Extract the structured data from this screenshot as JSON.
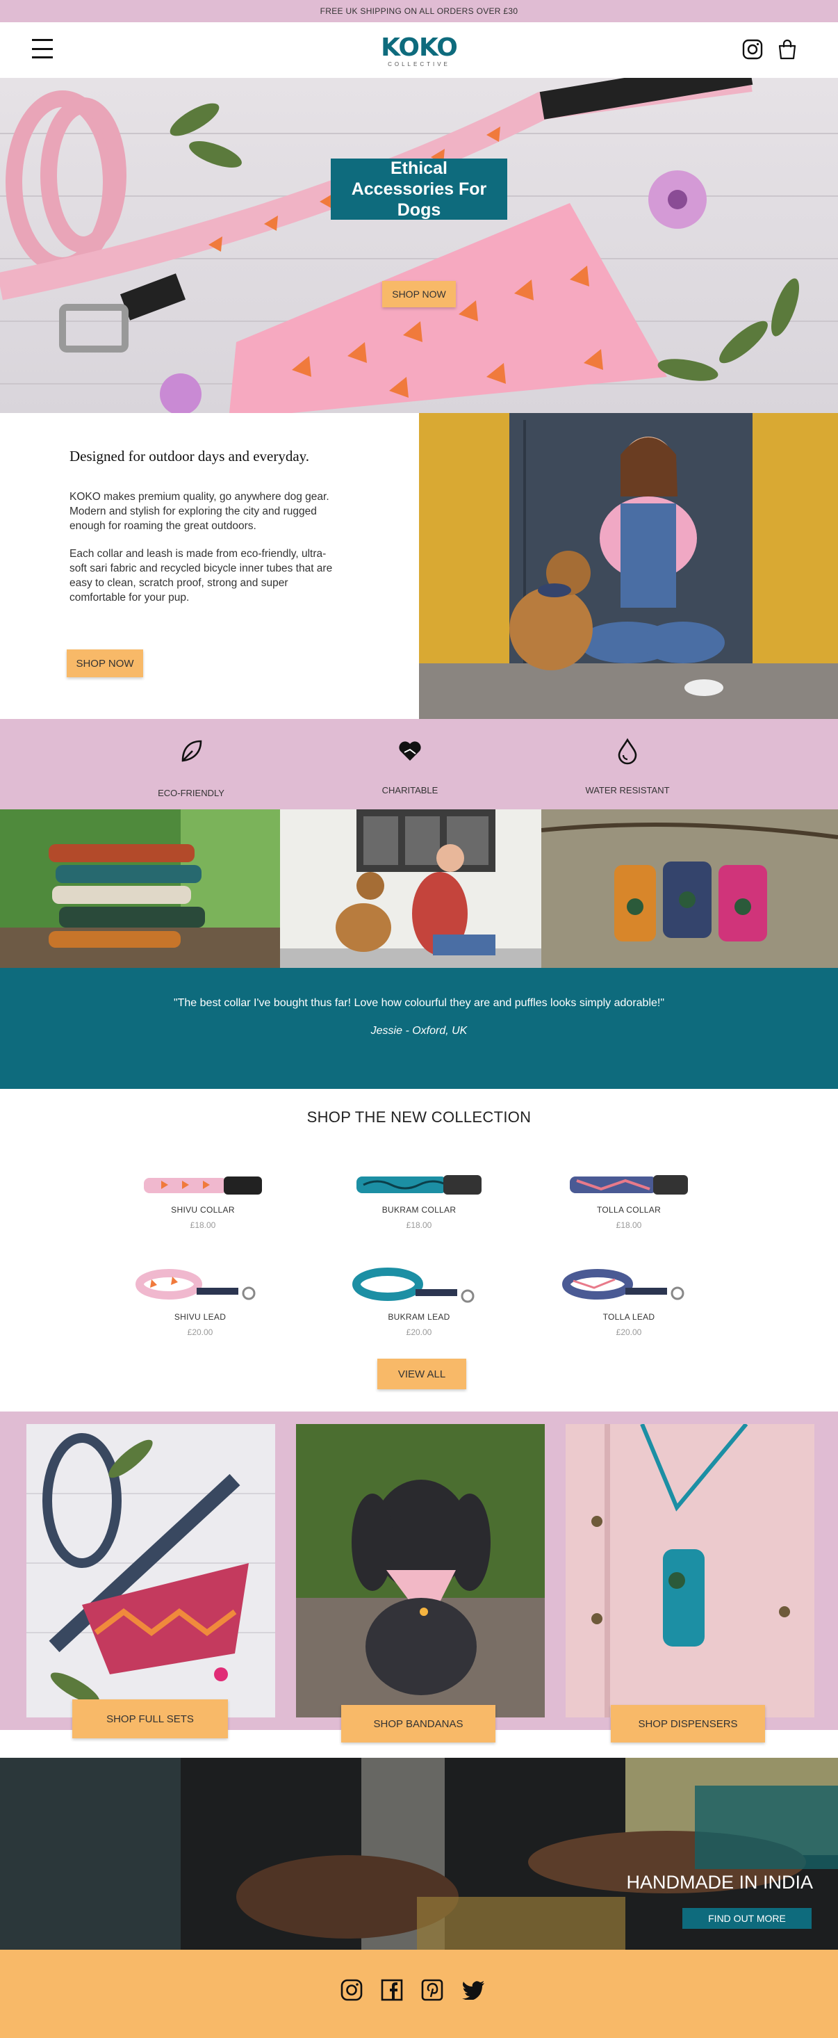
{
  "announcement": "FREE UK SHIPPING ON ALL ORDERS OVER £30",
  "header": {
    "logo_word": "KOKO",
    "logo_sub": "COLLECTIVE"
  },
  "hero": {
    "title": "Ethical Accessories For Dogs",
    "button": "SHOP NOW"
  },
  "about": {
    "heading": "Designed for outdoor days and everyday.",
    "para1": "KOKO makes premium quality, go anywhere dog gear. Modern and stylish for exploring the city and rugged enough for roaming the great outdoors.",
    "para2": "Each collar and leash is made from eco-friendly, ultra-soft sari fabric and recycled bicycle inner tubes that are easy to clean, scratch proof, strong and super comfortable for your pup.",
    "button": "SHOP NOW"
  },
  "features": [
    {
      "label": "ECO-FRIENDLY",
      "icon": "leaf-icon"
    },
    {
      "label": "CHARITABLE",
      "icon": "heart-hands-icon"
    },
    {
      "label": "WATER RESISTANT",
      "icon": "water-drop-icon"
    }
  ],
  "testimonial": {
    "quote": "\"The best collar I've bought thus far! Love how colourful they are and puffles looks simply adorable!\"",
    "author": "Jessie - Oxford, UK"
  },
  "collection": {
    "title": "SHOP THE NEW COLLECTION",
    "products": [
      {
        "name": "SHIVU COLLAR",
        "price": "£18.00"
      },
      {
        "name": "BUKRAM COLLAR",
        "price": "£18.00"
      },
      {
        "name": "TOLLA COLLAR",
        "price": "£18.00"
      },
      {
        "name": "SHIVU LEAD",
        "price": "£20.00"
      },
      {
        "name": "BUKRAM LEAD",
        "price": "£20.00"
      },
      {
        "name": "TOLLA LEAD",
        "price": "£20.00"
      }
    ],
    "view_all": "VIEW ALL"
  },
  "categories": [
    {
      "button": "SHOP FULL SETS"
    },
    {
      "button": "SHOP BANDANAS"
    },
    {
      "button": "SHOP DISPENSERS"
    }
  ],
  "handmade": {
    "title": "HANDMADE IN INDIA",
    "button": "FIND OUT MORE"
  },
  "footer": {
    "icons": [
      "instagram-icon",
      "facebook-icon",
      "pinterest-icon",
      "twitter-icon"
    ]
  },
  "colors": {
    "brand_teal": "#0e6b7d",
    "pink": "#e0bcd3",
    "orange": "#f8b968"
  }
}
